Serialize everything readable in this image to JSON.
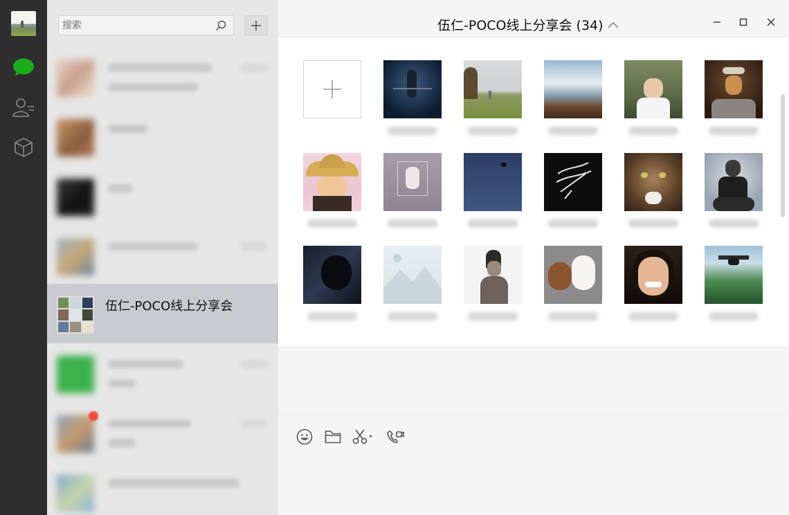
{
  "app": {
    "accent": "#1aad19"
  },
  "sidebar": {
    "icons": [
      "chat-icon",
      "contacts-icon",
      "favorites-icon"
    ]
  },
  "search": {
    "placeholder": "搜索"
  },
  "conversations": {
    "active": {
      "title": "伍仁-POCO线上分享会"
    }
  },
  "chat": {
    "title": "伍仁-POCO线上分享会 (34)"
  },
  "toolbar": {
    "icons": [
      "emoji-icon",
      "folder-icon",
      "scissors-icon",
      "video-call-icon"
    ]
  }
}
